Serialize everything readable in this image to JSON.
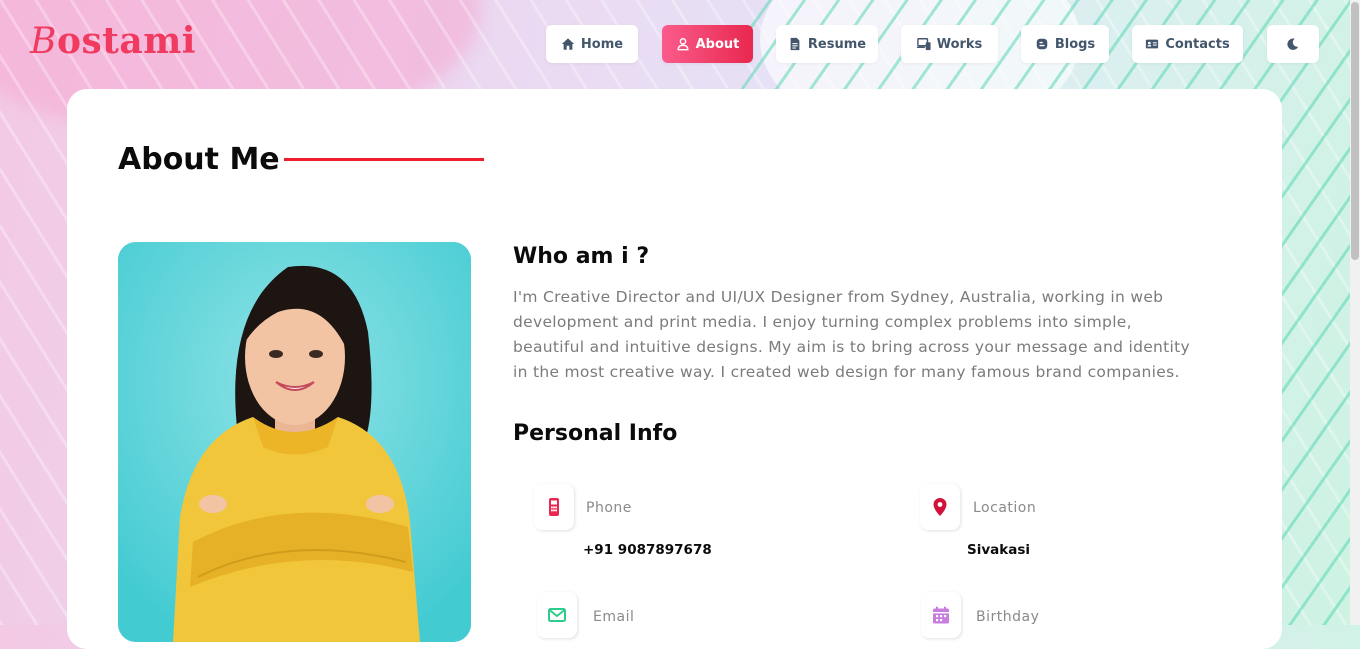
{
  "brand": {
    "logo_first": "B",
    "logo_rest": "ostami"
  },
  "nav": [
    {
      "label": "Home",
      "icon": "home-icon",
      "active": false
    },
    {
      "label": "About",
      "icon": "user-icon",
      "active": true
    },
    {
      "label": "Resume",
      "icon": "document-icon",
      "active": false
    },
    {
      "label": "Works",
      "icon": "devices-icon",
      "active": false
    },
    {
      "label": "Blogs",
      "icon": "blog-icon",
      "active": false
    },
    {
      "label": "Contacts",
      "icon": "contact-card-icon",
      "active": false
    }
  ],
  "theme_toggle": {
    "icon": "moon-icon"
  },
  "about": {
    "title": "About Me",
    "who_heading": "Who am i ?",
    "description": "I'm Creative Director and UI/UX Designer from Sydney, Australia, working in web development and print media. I enjoy turning complex problems into simple, beautiful and intuitive designs. My aim is to bring across your message and identity in the most creative way. I created web design for many famous brand companies.",
    "personal_info_heading": "Personal Info"
  },
  "personal_info": {
    "phone": {
      "label": "Phone",
      "value": "+91 9087897678",
      "icon": "mobile-phone-icon"
    },
    "location": {
      "label": "Location",
      "value": "Sivakasi",
      "icon": "map-pin-icon"
    },
    "email": {
      "label": "Email",
      "value": "",
      "icon": "envelope-icon"
    },
    "birthday": {
      "label": "Birthday",
      "value": "",
      "icon": "calendar-icon"
    }
  },
  "colors": {
    "accent": "#e8284f",
    "accent_light": "#fa5b8b",
    "title_line": "#ef1c2a",
    "phone_icon": "#e8284f",
    "location_icon": "#d3123a",
    "email_icon": "#2ecc8a",
    "birthday_icon": "#c97ce0"
  }
}
